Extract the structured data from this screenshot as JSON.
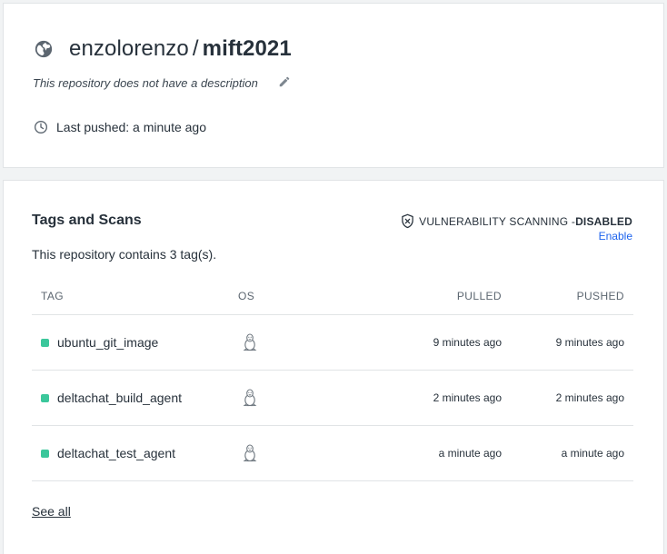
{
  "repo": {
    "namespace": "enzolorenzo",
    "separator": "/",
    "name": "mift2021",
    "description": "This repository does not have a description",
    "last_pushed": "Last pushed: a minute ago"
  },
  "tags_section": {
    "title": "Tags and Scans",
    "scan_label": "VULNERABILITY SCANNING - ",
    "scan_state": "DISABLED",
    "enable_label": "Enable",
    "count_text": "This repository contains 3 tag(s).",
    "headers": {
      "tag": "TAG",
      "os": "OS",
      "pulled": "PULLED",
      "pushed": "PUSHED"
    },
    "rows": [
      {
        "tag": "ubuntu_git_image",
        "os_icon": "linux-icon",
        "pulled": "9 minutes ago",
        "pushed": "9 minutes ago"
      },
      {
        "tag": "deltachat_build_agent",
        "os_icon": "linux-icon",
        "pulled": "2 minutes ago",
        "pushed": "2 minutes ago"
      },
      {
        "tag": "deltachat_test_agent",
        "os_icon": "linux-icon",
        "pulled": "a minute ago",
        "pushed": "a minute ago"
      }
    ],
    "see_all_label": "See all"
  },
  "colors": {
    "status_dot": "#3bc79b",
    "link": "#1d63ed",
    "background": "#f1f3f4"
  },
  "icons": [
    "globe-icon",
    "pencil-icon",
    "clock-icon",
    "shield-x-icon",
    "linux-icon"
  ]
}
